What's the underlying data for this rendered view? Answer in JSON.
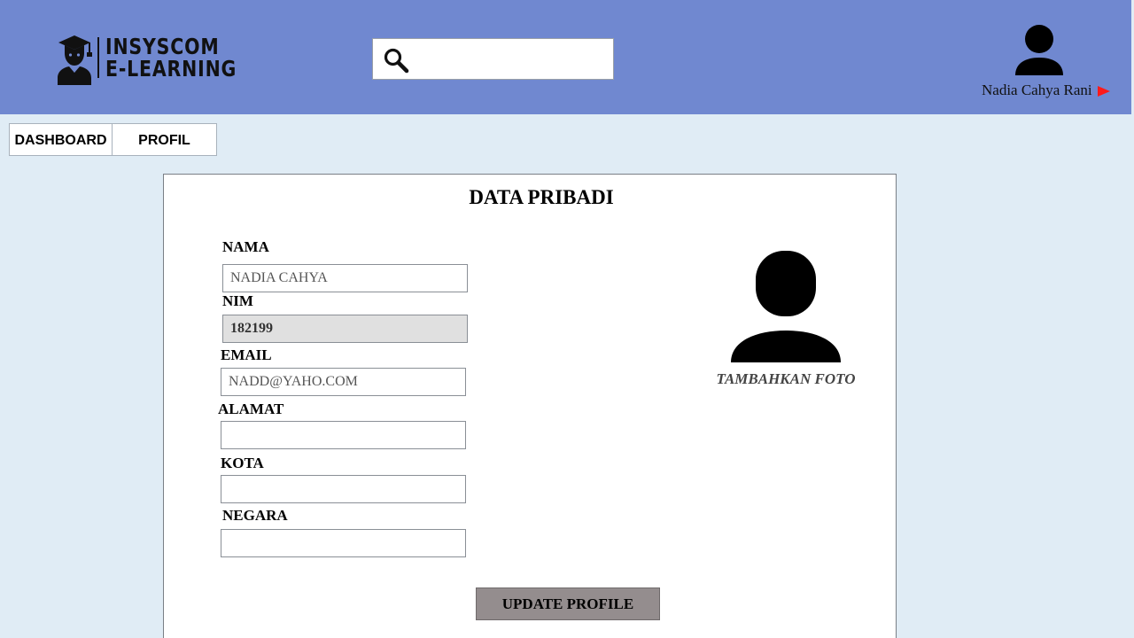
{
  "brand": {
    "line1": "INSYSCOM",
    "line2": "E-LEARNING"
  },
  "search": {
    "value": "",
    "placeholder": ""
  },
  "user": {
    "name": "Nadia Cahya Rani",
    "arrow_color": "#ff1a1a"
  },
  "nav": {
    "tabs": [
      {
        "label": "DASHBOARD"
      },
      {
        "label": "PROFIL"
      }
    ]
  },
  "form": {
    "title": "DATA PRIBADI",
    "fields": {
      "nama": {
        "label": "NAMA",
        "value": "NADIA CAHYA"
      },
      "nim": {
        "label": "NIM",
        "value": "182199"
      },
      "email": {
        "label": "EMAIL",
        "value": "NADD@YAHO.COM"
      },
      "alamat": {
        "label": "ALAMAT",
        "value": ""
      },
      "kota": {
        "label": "KOTA",
        "value": ""
      },
      "negara": {
        "label": "NEGARA",
        "value": ""
      }
    },
    "photo_label": "TAMBAHKAN FOTO",
    "submit_label": "UPDATE PROFILE"
  },
  "icons": {
    "logo": "graduate-icon",
    "search": "search-icon",
    "avatar": "user-icon",
    "menu": "triangle-right-icon",
    "photo": "user-photo-icon"
  },
  "colors": {
    "header_bg": "#7088d0",
    "page_bg": "#e0ecf5",
    "button_bg": "#948d8e"
  }
}
